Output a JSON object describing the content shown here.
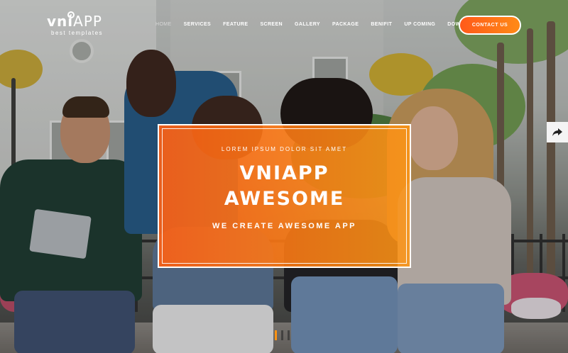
{
  "brand": {
    "logo_bold": "vni",
    "logo_light": "APP",
    "tagline": "best templates"
  },
  "nav": {
    "items": [
      {
        "label": "HOME",
        "active": true
      },
      {
        "label": "SERVICES",
        "active": false
      },
      {
        "label": "FEATURE",
        "active": false
      },
      {
        "label": "SCREEN",
        "active": false
      },
      {
        "label": "GALLERY",
        "active": false
      },
      {
        "label": "PACKAGE",
        "active": false
      },
      {
        "label": "BENIFIT",
        "active": false
      },
      {
        "label": "UP COMING",
        "active": false
      },
      {
        "label": "DOWNLOAD APP",
        "active": false
      }
    ],
    "contact_label": "CONTACT US"
  },
  "hero": {
    "eyebrow": "LOREM IPSUM DOLOR SIT AMET",
    "title_line1": "VNIAPP",
    "title_line2": "AWESOME",
    "subtitle": "WE CREATE AWESOME APP"
  },
  "share": {
    "icon": "share-arrow-icon"
  },
  "slider": {
    "slides": 3,
    "current": 1
  },
  "colors": {
    "accent_start": "#ff5a1a",
    "accent_end": "#ff8a16",
    "white": "#ffffff"
  }
}
